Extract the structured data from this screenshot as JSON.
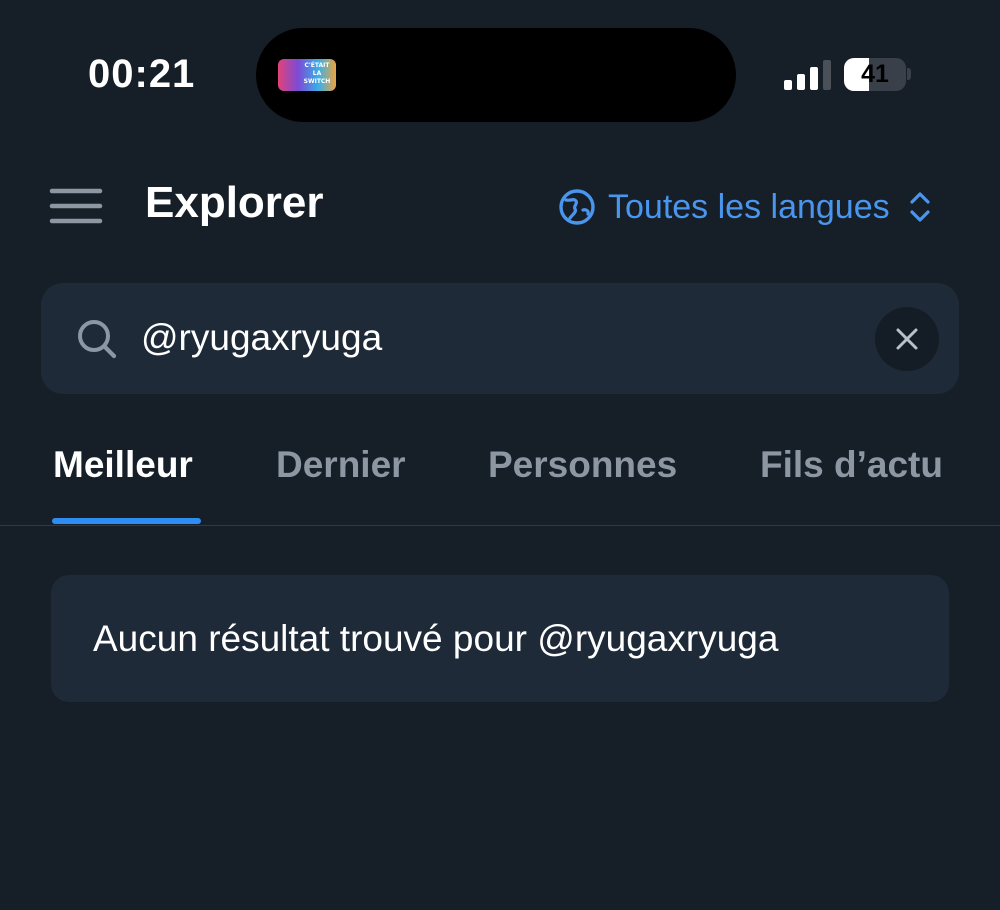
{
  "status_bar": {
    "time": "00:21",
    "battery_level": "41",
    "battery_fraction": 0.41,
    "signal_bars_active": 3,
    "signal_bars_total": 4,
    "now_playing_art_text": "C'ÉTAIT LA SWITCH"
  },
  "header": {
    "title": "Explorer",
    "menu_icon": "hamburger-menu-icon",
    "language_icon": "globe-icon",
    "language_label": "Toutes les langues",
    "language_chevron": "chevron-up-down-icon"
  },
  "search": {
    "value": "@ryugaxryuga",
    "icon": "search-icon",
    "clear_icon": "close-icon"
  },
  "tabs": [
    {
      "label": "Meilleur",
      "active": true
    },
    {
      "label": "Dernier",
      "active": false
    },
    {
      "label": "Personnes",
      "active": false
    },
    {
      "label": "Fils d’actu",
      "active": false
    }
  ],
  "results": {
    "empty_message": "Aucun résultat trouvé pour @ryugaxryuga"
  },
  "colors": {
    "background": "#161e27",
    "surface": "#1e2a38",
    "accent": "#2f8cf0",
    "link": "#4a96ee",
    "inactive_tab": "#8c97a3"
  }
}
